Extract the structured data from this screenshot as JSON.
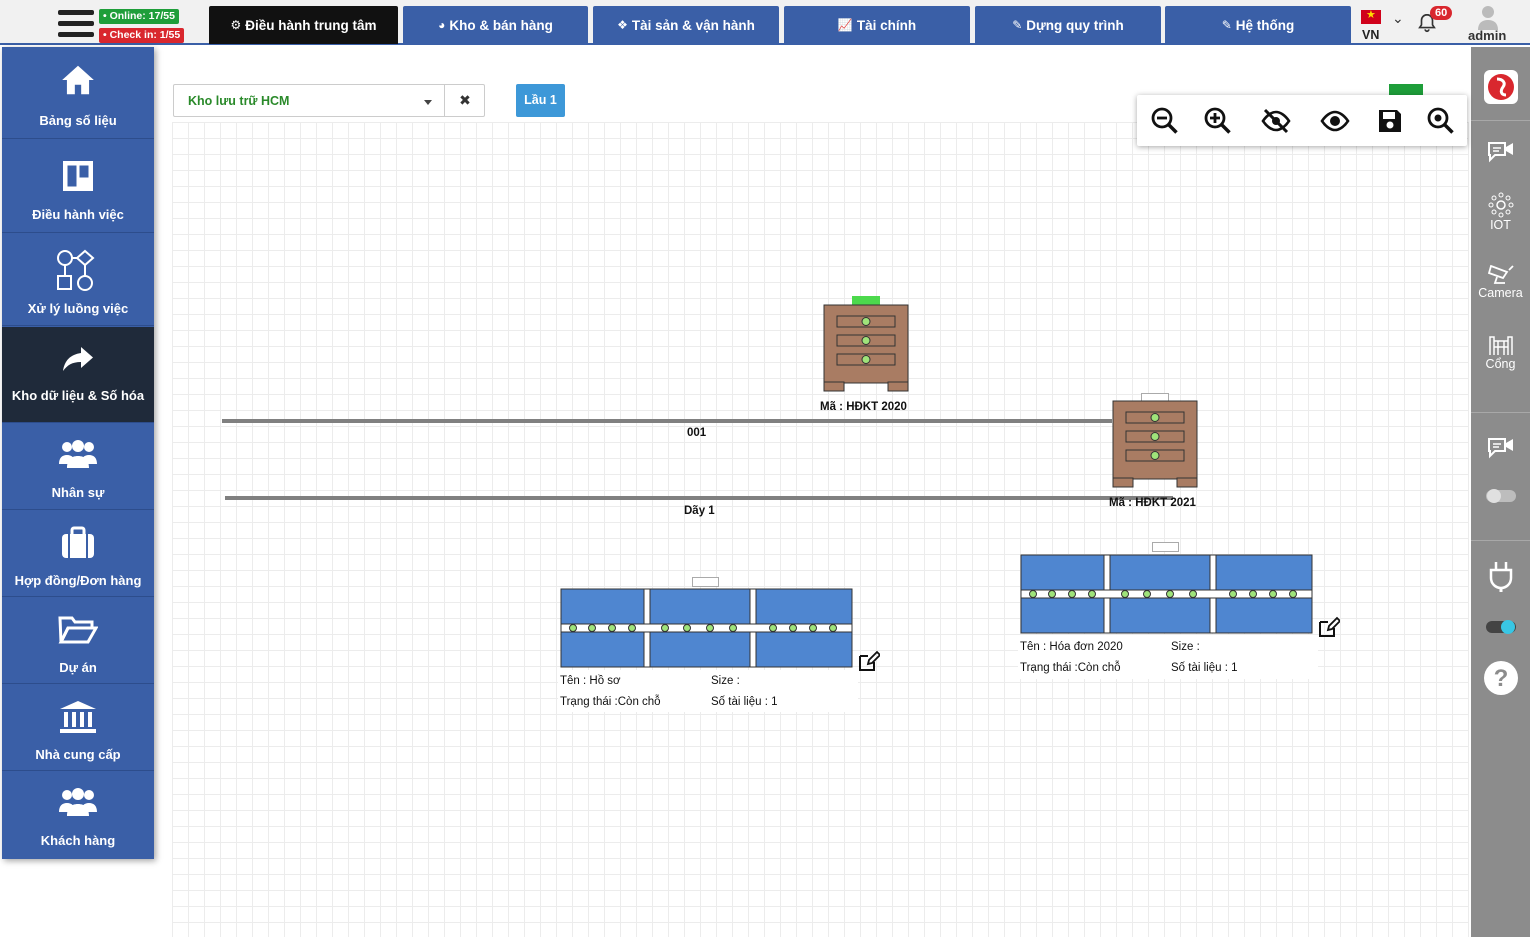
{
  "header": {
    "online_label": "• Online: 17/55",
    "checkin_label": "• Check in: 1/55",
    "tabs": [
      {
        "label": "Điều hành trung tâm"
      },
      {
        "label": "Kho & bán hàng"
      },
      {
        "label": "Tài sản & vận hành"
      },
      {
        "label": "Tài chính"
      },
      {
        "label": "Dựng quy trình"
      },
      {
        "label": "Hệ thống"
      }
    ],
    "language": "VN",
    "notification_count": "60",
    "username": "admin"
  },
  "sidebar": {
    "items": [
      {
        "label": "Bảng số liệu",
        "icon": "home-icon"
      },
      {
        "label": "Điều hành việc",
        "icon": "board-icon"
      },
      {
        "label": "Xử lý luồng việc",
        "icon": "workflow-icon"
      },
      {
        "label": "Kho dữ liệu & Số hóa",
        "icon": "share-icon"
      },
      {
        "label": "Nhân sự",
        "icon": "users-icon"
      },
      {
        "label": "Hợp đồng/Đơn hàng",
        "icon": "briefcase-icon"
      },
      {
        "label": "Dự án",
        "icon": "folder-open-icon"
      },
      {
        "label": "Nhà cung cấp",
        "icon": "bank-icon"
      },
      {
        "label": "Khách hàng",
        "icon": "users-icon"
      }
    ],
    "active_index": 3
  },
  "rightbar": {
    "items": [
      {
        "label": "",
        "icon": "logo-icon"
      },
      {
        "label": "",
        "icon": "video-chat-icon"
      },
      {
        "label": "IOT",
        "icon": "iot-icon"
      },
      {
        "label": "Camera",
        "icon": "camera-icon"
      },
      {
        "label": "Cổng",
        "icon": "gate-icon"
      },
      {
        "label": "",
        "icon": "video-chat-icon"
      },
      {
        "label": "",
        "icon": "toggle-off-icon"
      },
      {
        "label": "",
        "icon": "plug-icon"
      },
      {
        "label": "",
        "icon": "toggle-on-icon"
      },
      {
        "label": "",
        "icon": "help-icon"
      }
    ]
  },
  "controls": {
    "store_select_value": "Kho lưu trữ HCM",
    "clear_symbol": "✖",
    "floor_button": "Lầu 1",
    "zoom_tools": [
      "zoom-out-icon",
      "zoom-in-icon",
      "hide-icon",
      "show-icon",
      "save-icon",
      "zoom-fit-icon"
    ]
  },
  "map": {
    "lines": [
      {
        "label": "001"
      },
      {
        "label": "Dãy 1"
      }
    ],
    "cabinets": [
      {
        "code_label": "Mã : HĐKT 2020",
        "status_color": "#4cd94c"
      },
      {
        "code_label": "Mã : HĐKT 2021",
        "status_color": "#ffffff"
      }
    ],
    "racks": [
      {
        "name_label": "Tên : Hồ sơ",
        "status_label": "Trạng thái :Còn chỗ",
        "size_label": "Size :",
        "docs_label": "Số tài liệu : 1"
      },
      {
        "name_label": "Tên : Hóa đơn 2020",
        "status_label": "Trạng thái :Còn chỗ",
        "size_label": "Size :",
        "docs_label": "Số tài liệu : 1"
      }
    ]
  },
  "colors": {
    "primary": "#3a5fa7",
    "active_tab": "#111111",
    "cabinet": "#a97c63",
    "rack": "#4f86d0",
    "online": "#1e9e3a",
    "checkin": "#d9272e"
  }
}
